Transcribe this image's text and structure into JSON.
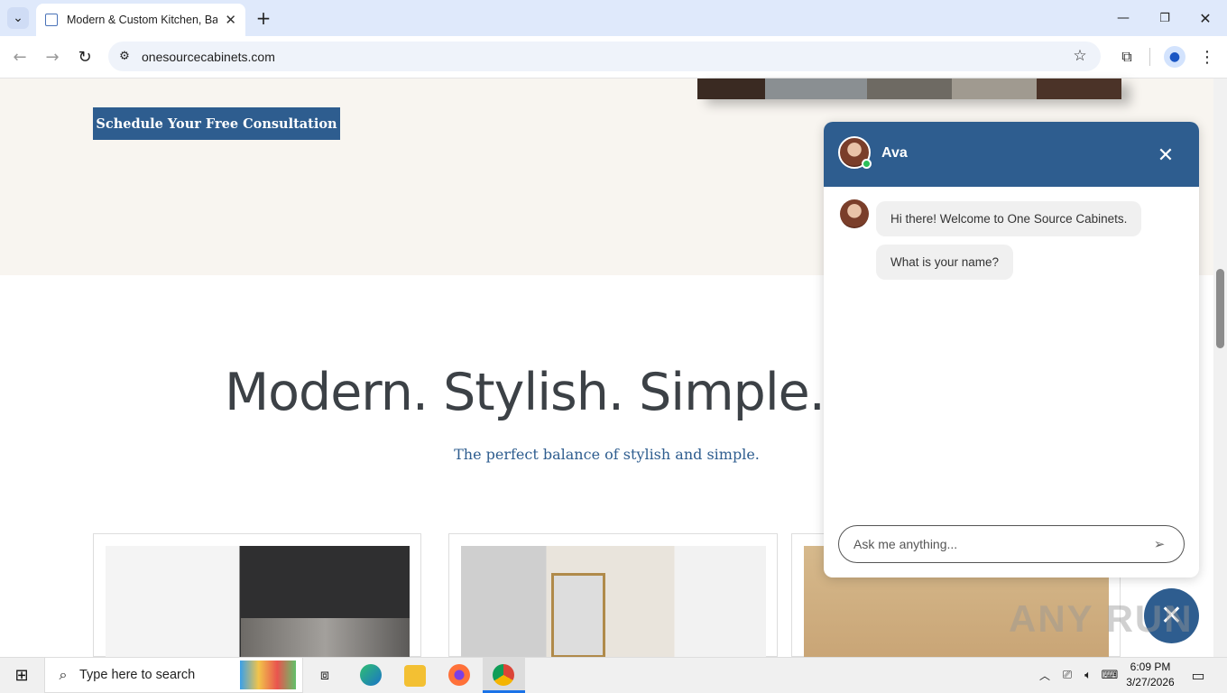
{
  "browser": {
    "tab_title": "Modern & Custom Kitchen, Bat",
    "url": "onesourcecabinets.com",
    "new_tab_label": "+"
  },
  "page": {
    "cta_label": "Schedule Your Free Consultation",
    "heading": "Modern. Stylish. Simple. C",
    "subheading": "The perfect balance of stylish and simple."
  },
  "chat": {
    "agent_name": "Ava",
    "messages": [
      "Hi there! Welcome to One Source Cabinets.",
      "What is your name?"
    ],
    "input_placeholder": "Ask me anything..."
  },
  "taskbar": {
    "search_placeholder": "Type here to search",
    "time": "6:09 PM",
    "date": "3/27/2026"
  },
  "colors": {
    "brand": "#2e5d8f",
    "hero_bg": "#f8f5f0",
    "heading": "#3c4146"
  },
  "watermark": "ANY RUN"
}
